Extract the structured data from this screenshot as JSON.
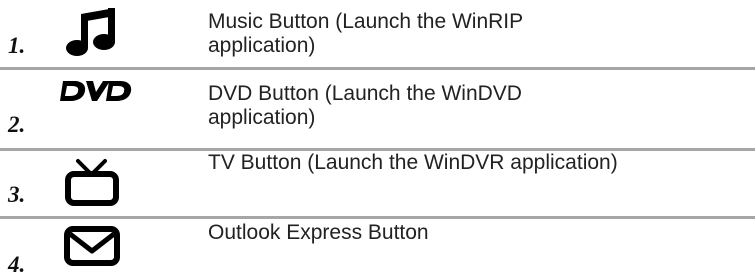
{
  "rows": [
    {
      "number": "1.",
      "icon": "music-note-icon",
      "description": "Music Button (Launch the WinRIP\napplication)"
    },
    {
      "number": "2.",
      "icon": "dvd-logo-icon",
      "description": "DVD Button (Launch the WinDVD\napplication)"
    },
    {
      "number": "3.",
      "icon": "tv-icon",
      "description": "TV Button (Launch the WinDVR application)"
    },
    {
      "number": "4.",
      "icon": "envelope-icon",
      "description": "Outlook Express Button"
    }
  ],
  "colors": {
    "divider": "#a6a6a6",
    "text": "#222222",
    "icon": "#000000"
  }
}
